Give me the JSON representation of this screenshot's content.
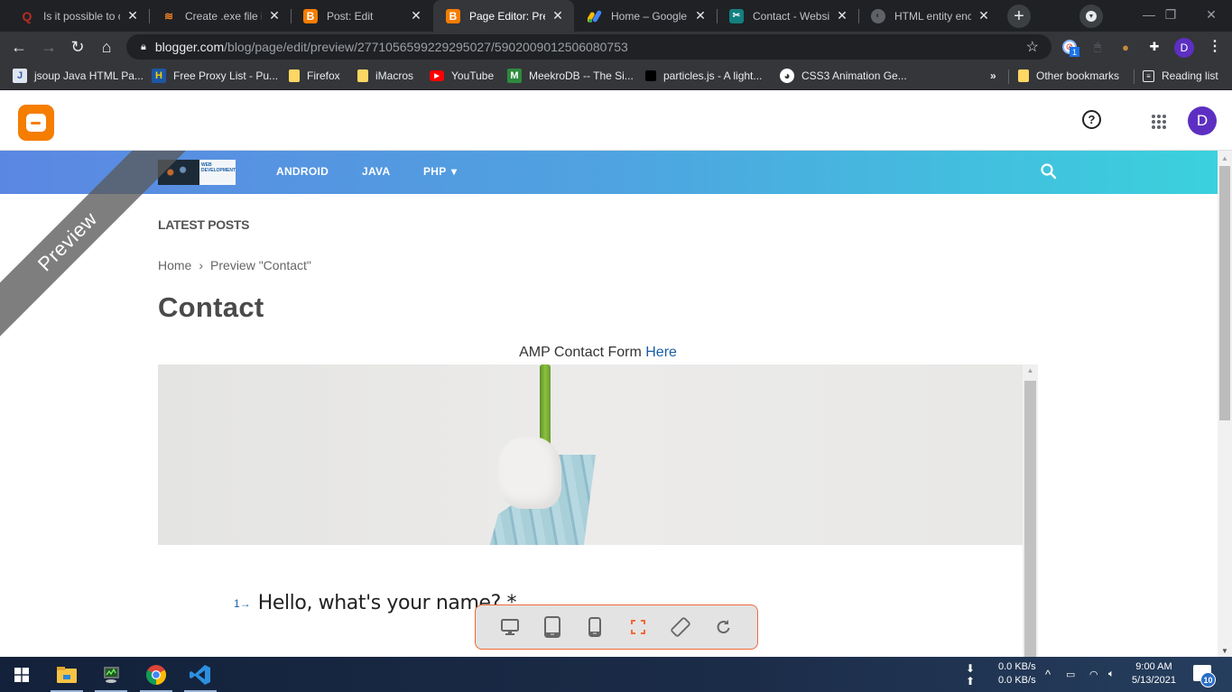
{
  "browser": {
    "tabs": [
      {
        "title": "Is it possible to cr",
        "icon": "quora-icon",
        "active": false
      },
      {
        "title": "Create .exe file in",
        "icon": "stackoverflow-icon",
        "active": false
      },
      {
        "title": "Post: Edit",
        "icon": "blogger-icon",
        "active": false
      },
      {
        "title": "Page Editor: Previ",
        "icon": "blogger-icon",
        "active": true
      },
      {
        "title": "Home – Google A",
        "icon": "google-adsense-icon",
        "active": false
      },
      {
        "title": "Contact - Website",
        "icon": "website-icon",
        "active": false
      },
      {
        "title": "HTML entity enco",
        "icon": "globe-icon",
        "active": false
      }
    ],
    "close_glyph": "✕",
    "new_tab_glyph": "+",
    "url": {
      "host": "blogger.com",
      "path": "/blog/page/edit/preview/2771056599229295027/5902009012506080753"
    },
    "extension_badge": "1",
    "profile_initial": "D",
    "bookmarks": [
      {
        "label": "jsoup Java HTML Pa...",
        "icon": "jsoup-icon",
        "glyph": "J"
      },
      {
        "label": "Free Proxy List - Pu...",
        "icon": "proxy-list-icon",
        "glyph": "H"
      },
      {
        "label": "Firefox",
        "icon": "folder-icon"
      },
      {
        "label": "iMacros",
        "icon": "folder-icon"
      },
      {
        "label": "YouTube",
        "icon": "youtube-icon"
      },
      {
        "label": "MeekroDB -- The Si...",
        "icon": "meekrodb-icon",
        "glyph": "M"
      },
      {
        "label": "particles.js - A light...",
        "icon": "particles-icon"
      },
      {
        "label": "CSS3 Animation Ge...",
        "icon": "globe-icon"
      }
    ],
    "bookmarks_overflow": "»",
    "other_bookmarks": "Other bookmarks",
    "reading_list": "Reading list"
  },
  "blogger": {
    "avatar_initial": "D",
    "help_glyph": "?"
  },
  "preview": {
    "ribbon": "Preview",
    "nav": {
      "logo_text": "WEB DEVELOPMENT",
      "items": [
        "ANDROID",
        "JAVA",
        "PHP"
      ],
      "dropdown_glyph": "▾"
    },
    "latest_posts": "LATEST POSTS",
    "breadcrumb": {
      "home": "Home",
      "separator": "›",
      "current": "Preview \"Contact\""
    },
    "page_title": "Contact",
    "amp_text": "AMP Contact Form ",
    "amp_link": "Here",
    "form": {
      "question_number": "1",
      "question_arrow": "→",
      "question": "Hello, what's your name? *"
    },
    "device_toolbar": [
      {
        "name": "desktop-view-button",
        "icon": "monitor-icon"
      },
      {
        "name": "tablet-view-button",
        "icon": "tablet-icon"
      },
      {
        "name": "mobile-view-button",
        "icon": "phone-icon"
      },
      {
        "name": "fullscreen-button",
        "icon": "fullscreen-icon",
        "active": true
      },
      {
        "name": "rotate-button",
        "icon": "rotate-icon"
      },
      {
        "name": "refresh-button",
        "icon": "refresh-icon"
      }
    ],
    "accent_color": "#f0693a"
  },
  "taskbar": {
    "net_down": "0.0 KB/s",
    "net_up": "0.0 KB/s",
    "time": "9:00 AM",
    "date": "5/13/2021",
    "notifications": "10"
  }
}
